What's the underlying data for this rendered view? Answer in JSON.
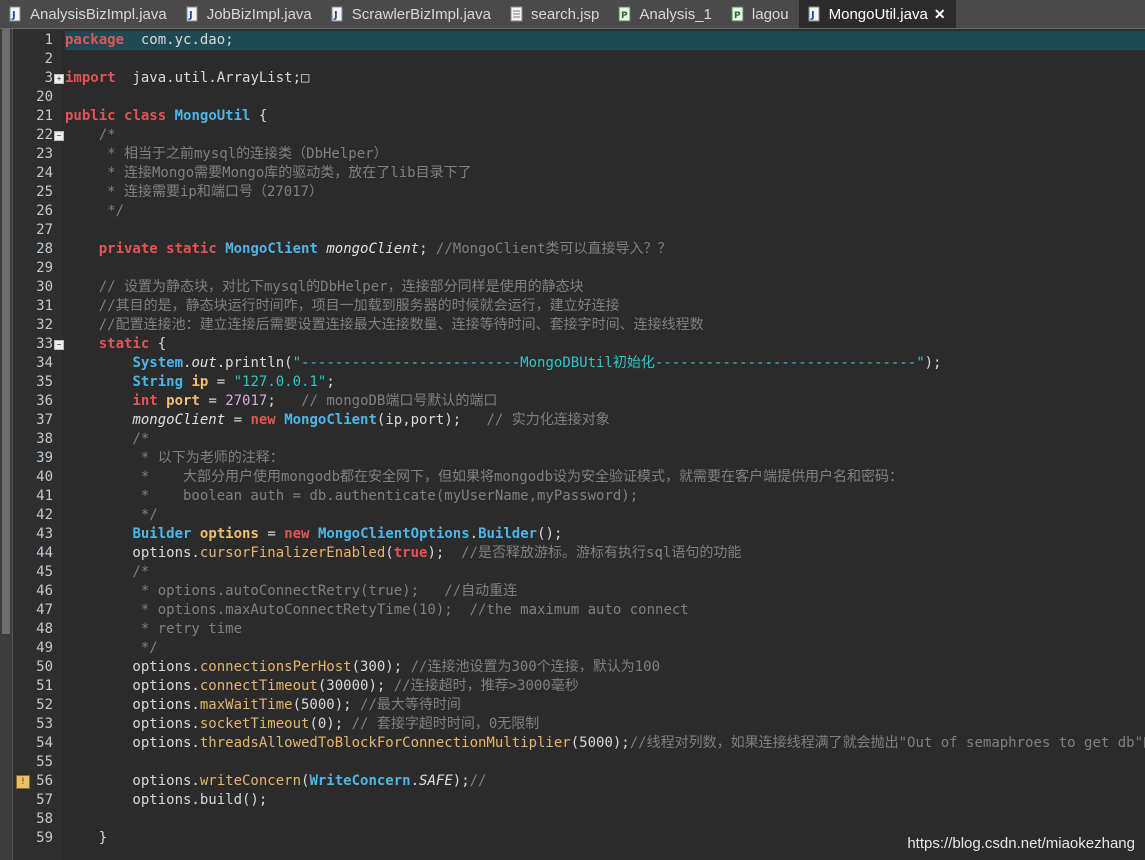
{
  "tabs": [
    {
      "label": "AnalysisBizImpl.java",
      "icon": "java-file-icon"
    },
    {
      "label": "JobBizImpl.java",
      "icon": "java-file-icon"
    },
    {
      "label": "ScrawlerBizImpl.java",
      "icon": "java-file-icon"
    },
    {
      "label": "search.jsp",
      "icon": "jsp-file-icon"
    },
    {
      "label": "Analysis_1",
      "icon": "page-icon"
    },
    {
      "label": "lagou",
      "icon": "page-icon"
    },
    {
      "label": "MongoUtil.java",
      "icon": "java-file-icon",
      "active": true,
      "close": "✕"
    }
  ],
  "editor": {
    "lines": [
      {
        "n": "1",
        "tokens": [
          [
            "kw",
            "package"
          ],
          [
            "",
            "  com.yc.dao;"
          ]
        ]
      },
      {
        "n": "2",
        "tokens": []
      },
      {
        "n": "3",
        "fold": "+",
        "tokens": [
          [
            "kw",
            "import"
          ],
          [
            "",
            "  java.util.ArrayList;"
          ],
          [
            "",
            "□"
          ]
        ]
      },
      {
        "n": "20",
        "tokens": []
      },
      {
        "n": "21",
        "tokens": [
          [
            "kw",
            "public"
          ],
          [
            "",
            " "
          ],
          [
            "kw",
            "class"
          ],
          [
            "",
            " "
          ],
          [
            "ty",
            "MongoUtil"
          ],
          [
            "",
            " {"
          ]
        ]
      },
      {
        "n": "22",
        "fold": "−",
        "tokens": [
          [
            "cm",
            "    /*"
          ]
        ]
      },
      {
        "n": "23",
        "tokens": [
          [
            "cm",
            "     * 相当于之前mysql的连接类（DbHelper）"
          ]
        ]
      },
      {
        "n": "24",
        "tokens": [
          [
            "cm",
            "     * 连接Mongo需要Mongo库的驱动类，放在了lib目录下了"
          ]
        ]
      },
      {
        "n": "25",
        "tokens": [
          [
            "cm",
            "     * 连接需要ip和端口号（27017）"
          ]
        ]
      },
      {
        "n": "26",
        "tokens": [
          [
            "cm",
            "     */"
          ]
        ]
      },
      {
        "n": "27",
        "tokens": []
      },
      {
        "n": "28",
        "tokens": [
          [
            "",
            "    "
          ],
          [
            "kw",
            "private"
          ],
          [
            "",
            " "
          ],
          [
            "kw",
            "static"
          ],
          [
            "",
            " "
          ],
          [
            "ty",
            "MongoClient"
          ],
          [
            "",
            " "
          ],
          [
            "fd",
            "mongoClient"
          ],
          [
            "",
            "; "
          ],
          [
            "cm",
            "//MongoClient类可以直接导入？？"
          ]
        ]
      },
      {
        "n": "29",
        "tokens": []
      },
      {
        "n": "30",
        "tokens": [
          [
            "cm",
            "    // 设置为静态块，对比下mysql的DbHelper，连接部分同样是使用的静态块"
          ]
        ]
      },
      {
        "n": "31",
        "tokens": [
          [
            "cm",
            "    //其目的是，静态块运行时间咋，项目一加载到服务器的时候就会运行，建立好连接"
          ]
        ]
      },
      {
        "n": "32",
        "tokens": [
          [
            "cm",
            "    //配置连接池：建立连接后需要设置连接最大连接数量、连接等待时间、套接字时间、连接线程数"
          ]
        ]
      },
      {
        "n": "33",
        "fold": "−",
        "tokens": [
          [
            "",
            "    "
          ],
          [
            "kw",
            "static"
          ],
          [
            "",
            " {"
          ]
        ]
      },
      {
        "n": "34",
        "tokens": [
          [
            "",
            "        "
          ],
          [
            "ty",
            "System"
          ],
          [
            "",
            "."
          ],
          [
            "fd",
            "out"
          ],
          [
            "",
            ".println("
          ],
          [
            "st",
            "\"--------------------------MongoDBUtil初始化-------------------------------\""
          ],
          [
            "",
            ");"
          ]
        ]
      },
      {
        "n": "35",
        "tokens": [
          [
            "",
            "        "
          ],
          [
            "ty",
            "String"
          ],
          [
            "",
            " "
          ],
          [
            "vr",
            "ip"
          ],
          [
            "",
            " = "
          ],
          [
            "st",
            "\"127.0.0.1\""
          ],
          [
            "",
            ";"
          ]
        ]
      },
      {
        "n": "36",
        "tokens": [
          [
            "",
            "        "
          ],
          [
            "kw",
            "int"
          ],
          [
            "",
            " "
          ],
          [
            "vr",
            "port"
          ],
          [
            "",
            " = "
          ],
          [
            "nm",
            "27017"
          ],
          [
            "",
            ";   "
          ],
          [
            "cm",
            "// mongoDB端口号默认的端口"
          ]
        ]
      },
      {
        "n": "37",
        "tokens": [
          [
            "",
            "        "
          ],
          [
            "fd",
            "mongoClient"
          ],
          [
            "",
            " = "
          ],
          [
            "kw",
            "new"
          ],
          [
            "",
            " "
          ],
          [
            "ty",
            "MongoClient"
          ],
          [
            "",
            "(ip,port);   "
          ],
          [
            "cm",
            "// 实力化连接对象"
          ]
        ]
      },
      {
        "n": "38",
        "tokens": [
          [
            "cm",
            "        /*"
          ]
        ]
      },
      {
        "n": "39",
        "tokens": [
          [
            "cm",
            "         * 以下为老师的注释："
          ]
        ]
      },
      {
        "n": "40",
        "tokens": [
          [
            "cm",
            "         *    大部分用户使用mongodb都在安全网下，但如果将mongodb设为安全验证模式，就需要在客户端提供用户名和密码："
          ]
        ]
      },
      {
        "n": "41",
        "tokens": [
          [
            "cm",
            "         *    boolean auth = db.authenticate(myUserName,myPassword);"
          ]
        ]
      },
      {
        "n": "42",
        "tokens": [
          [
            "cm",
            "         */"
          ]
        ]
      },
      {
        "n": "43",
        "tokens": [
          [
            "",
            "        "
          ],
          [
            "ty",
            "Builder"
          ],
          [
            "",
            " "
          ],
          [
            "vr",
            "options"
          ],
          [
            "",
            " = "
          ],
          [
            "kw",
            "new"
          ],
          [
            "",
            " "
          ],
          [
            "ty",
            "MongoClientOptions"
          ],
          [
            "",
            "."
          ],
          [
            "ty",
            "Builder"
          ],
          [
            "",
            "();"
          ]
        ]
      },
      {
        "n": "44",
        "tokens": [
          [
            "",
            "        options."
          ],
          [
            "me",
            "cursorFinalizerEnabled"
          ],
          [
            "",
            "("
          ],
          [
            "kw",
            "true"
          ],
          [
            "",
            ");  "
          ],
          [
            "cm",
            "//是否释放游标。游标有执行sql语句的功能"
          ]
        ]
      },
      {
        "n": "45",
        "tokens": [
          [
            "cm",
            "        /*"
          ]
        ]
      },
      {
        "n": "46",
        "tokens": [
          [
            "cm",
            "         * options.autoConnectRetry(true);   //自动重连"
          ]
        ]
      },
      {
        "n": "47",
        "tokens": [
          [
            "cm",
            "         * options.maxAutoConnectRetyTime(10);  //the maximum auto connect"
          ]
        ]
      },
      {
        "n": "48",
        "tokens": [
          [
            "cm",
            "         * retry time"
          ]
        ]
      },
      {
        "n": "49",
        "tokens": [
          [
            "cm",
            "         */"
          ]
        ]
      },
      {
        "n": "50",
        "tokens": [
          [
            "",
            "        options."
          ],
          [
            "me",
            "connectionsPerHost"
          ],
          [
            "",
            "(300); "
          ],
          [
            "cm",
            "//连接池设置为300个连接，默认为100"
          ]
        ]
      },
      {
        "n": "51",
        "tokens": [
          [
            "",
            "        options."
          ],
          [
            "me",
            "connectTimeout"
          ],
          [
            "",
            "(30000); "
          ],
          [
            "cm",
            "//连接超时，推荐>3000毫秒"
          ]
        ]
      },
      {
        "n": "52",
        "tokens": [
          [
            "",
            "        options."
          ],
          [
            "me",
            "maxWaitTime"
          ],
          [
            "",
            "(5000); "
          ],
          [
            "cm",
            "//最大等待时间"
          ]
        ]
      },
      {
        "n": "53",
        "tokens": [
          [
            "",
            "        options."
          ],
          [
            "me",
            "socketTimeout"
          ],
          [
            "",
            "(0); "
          ],
          [
            "cm",
            "// 套接字超时时间，0无限制"
          ]
        ]
      },
      {
        "n": "54",
        "tokens": [
          [
            "",
            "        options."
          ],
          [
            "me",
            "threadsAllowedToBlockForConnectionMultiplier"
          ],
          [
            "",
            "(5000);"
          ],
          [
            "cm",
            "//线程对列数，如果连接线程满了就会抛出\"Out of semaphroes to get db\"的错"
          ]
        ]
      },
      {
        "n": "55",
        "tokens": []
      },
      {
        "n": "56",
        "marker": "!",
        "tokens": [
          [
            "",
            "        options."
          ],
          [
            "me",
            "writeConcern"
          ],
          [
            "",
            "("
          ],
          [
            "ty",
            "WriteConcern"
          ],
          [
            "",
            "."
          ],
          [
            "fd",
            "SAFE"
          ],
          [
            "",
            ");"
          ],
          [
            "cm",
            "//"
          ]
        ]
      },
      {
        "n": "57",
        "tokens": [
          [
            "",
            "        options.build();"
          ]
        ]
      },
      {
        "n": "58",
        "tokens": []
      },
      {
        "n": "59",
        "tokens": [
          [
            "",
            "    }"
          ]
        ]
      }
    ]
  },
  "watermark": "https://blog.csdn.net/miaokezhang"
}
